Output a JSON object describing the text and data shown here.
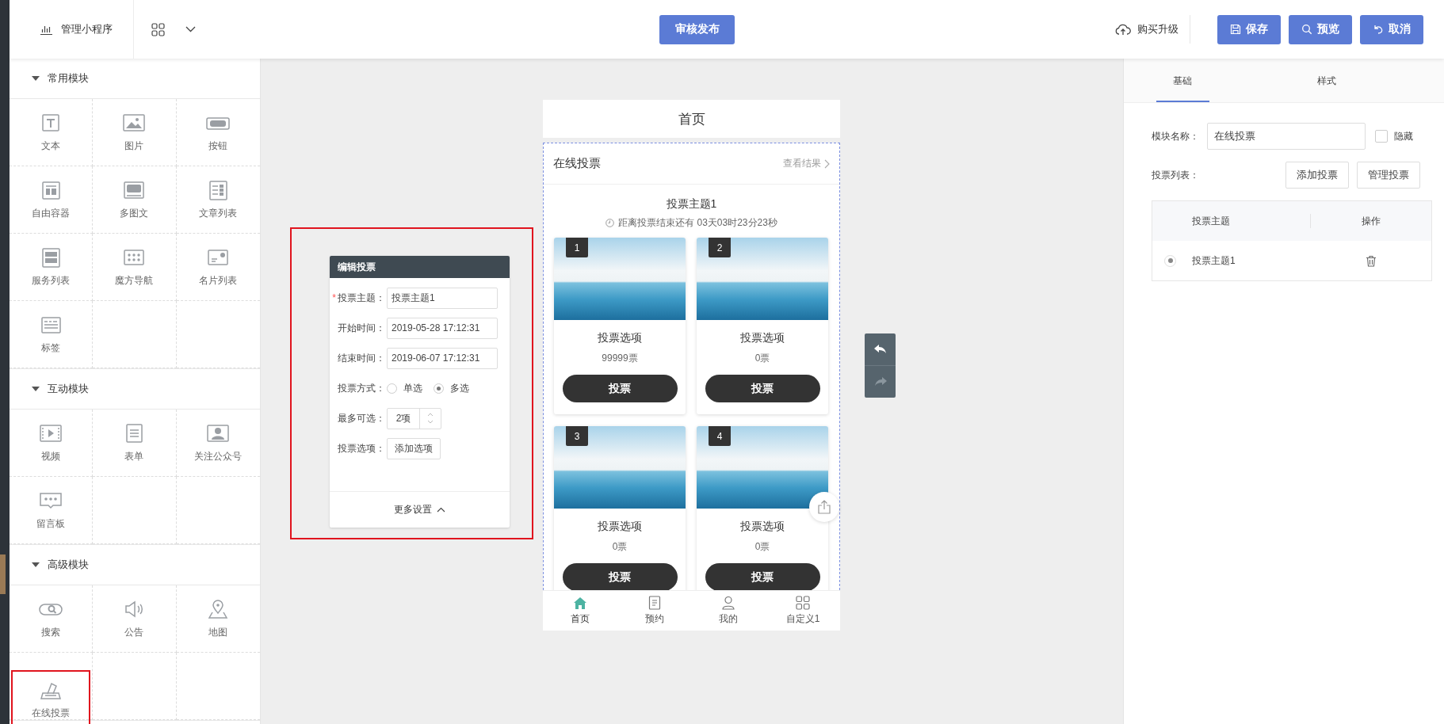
{
  "topbar": {
    "app_menu": "管理小程序",
    "publish_button": "审核发布",
    "upgrade_link": "购买升级",
    "buttons": [
      "保存",
      "预览",
      "取消"
    ]
  },
  "sidebar": {
    "sections": [
      {
        "title": "常用模块",
        "expanded": true,
        "items": [
          {
            "label": "文本",
            "highlighted": false
          },
          {
            "label": "图片",
            "highlighted": false
          },
          {
            "label": "按钮",
            "highlighted": false
          },
          {
            "label": "自由容器",
            "highlighted": false
          },
          {
            "label": "多图文",
            "highlighted": false
          },
          {
            "label": "文章列表",
            "highlighted": false
          },
          {
            "label": "服务列表",
            "highlighted": false
          },
          {
            "label": "魔方导航",
            "highlighted": false
          },
          {
            "label": "名片列表",
            "highlighted": false
          },
          {
            "label": "标签",
            "highlighted": false
          }
        ]
      },
      {
        "title": "互动模块",
        "expanded": true,
        "items": [
          {
            "label": "视频",
            "highlighted": false
          },
          {
            "label": "表单",
            "highlighted": false
          },
          {
            "label": "关注公众号",
            "highlighted": false
          },
          {
            "label": "留言板",
            "highlighted": false
          }
        ]
      },
      {
        "title": "高级模块",
        "expanded": true,
        "items": [
          {
            "label": "搜索",
            "highlighted": false
          },
          {
            "label": "公告",
            "highlighted": false
          },
          {
            "label": "地图",
            "highlighted": false
          },
          {
            "label": "在线投票",
            "highlighted": true
          }
        ]
      }
    ]
  },
  "editor": {
    "title": "编辑投票",
    "highlighted": true,
    "fields": [
      {
        "kind": "text",
        "required_mark": "*",
        "label": "投票主题：",
        "value": "投票主题1"
      },
      {
        "kind": "text",
        "label": "开始时间：",
        "value": "2019-05-28 17:12:31"
      },
      {
        "kind": "text",
        "label": "结束时间：",
        "value": "2019-06-07 17:12:31"
      },
      {
        "kind": "radio",
        "label": "投票方式：",
        "options": [
          {
            "label": "单选",
            "selected": false
          },
          {
            "label": "多选",
            "selected": true
          }
        ]
      },
      {
        "kind": "number",
        "label": "最多可选：",
        "value": "2项"
      },
      {
        "kind": "button",
        "label": "投票选项：",
        "value": "添加选项"
      }
    ],
    "more": "更多设置"
  },
  "phone": {
    "title": "首页",
    "module_title": "在线投票",
    "results_link": "查看结果",
    "topic": "投票主题1",
    "countdown": "距离投票结束还有 03天03时23分23秒",
    "options": [
      {
        "number": "1",
        "label": "投票选项",
        "votes": "99999票",
        "button": "投票"
      },
      {
        "number": "2",
        "label": "投票选项",
        "votes": "0票",
        "button": "投票"
      },
      {
        "number": "3",
        "label": "投票选项",
        "votes": "0票",
        "button": "投票"
      },
      {
        "number": "4",
        "label": "投票选项",
        "votes": "0票",
        "button": "投票"
      }
    ],
    "tabbar": [
      {
        "label": "首页",
        "selected": true
      },
      {
        "label": "预约",
        "selected": false
      },
      {
        "label": "我的",
        "selected": false
      },
      {
        "label": "自定义1",
        "selected": false
      }
    ]
  },
  "props": {
    "tabs": [
      {
        "label": "基础",
        "selected": true
      },
      {
        "label": "样式",
        "selected": false
      }
    ],
    "name_label": "模块名称：",
    "name_value": "在线投票",
    "hide": {
      "label": "隐藏",
      "checked": false
    },
    "list_label": "投票列表：",
    "buttons": [
      "添加投票",
      "管理投票"
    ],
    "table": {
      "columns": [
        "投票主题",
        "操作"
      ],
      "rows": [
        {
          "topic": "投票主题1",
          "selected": true
        }
      ]
    }
  }
}
